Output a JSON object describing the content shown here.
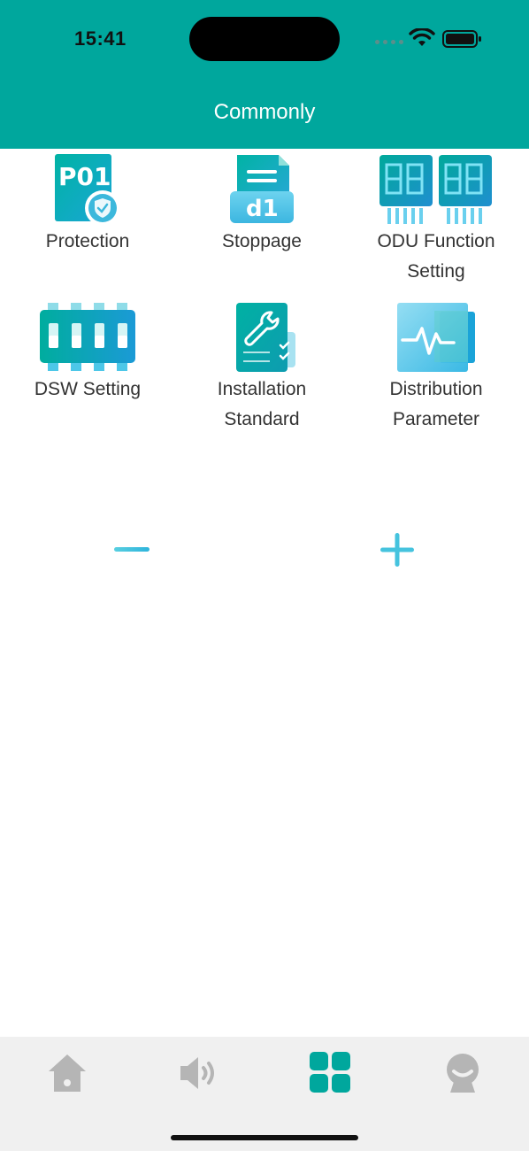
{
  "status_bar": {
    "time": "15:41"
  },
  "header": {
    "title": "Commonly"
  },
  "menu": {
    "items": [
      {
        "label": "Protection",
        "icon": "p01-protection-icon"
      },
      {
        "label": "Stoppage",
        "icon": "d1-stoppage-icon"
      },
      {
        "label": "ODU Function Setting",
        "icon": "segment-display-icon"
      },
      {
        "label": "DSW Setting",
        "icon": "dip-switch-icon"
      },
      {
        "label": "Installation Standard",
        "icon": "wrench-checklist-icon"
      },
      {
        "label": "Distribution Parameter",
        "icon": "pulse-monitor-icon"
      }
    ],
    "p01_text": "P01",
    "d1_text": "d1"
  },
  "zoom": {
    "minus": "zoom-out",
    "plus": "zoom-in"
  },
  "tabbar": {
    "tabs": [
      {
        "name": "home",
        "active": false
      },
      {
        "name": "sound",
        "active": false
      },
      {
        "name": "apps",
        "active": true
      },
      {
        "name": "service",
        "active": false
      }
    ]
  },
  "colors": {
    "brand": "#00A79D",
    "inactive_tab": "#b5b5b5",
    "accent_light": "#4fc3d9"
  }
}
